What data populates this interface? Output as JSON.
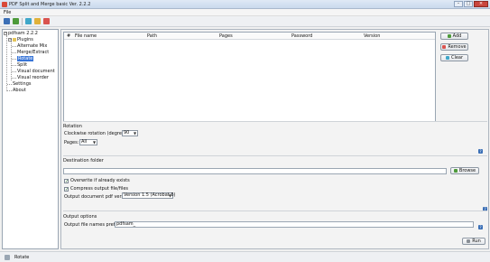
{
  "window": {
    "title": "PDF Split and Merge basic Ver. 2.2.2",
    "buttons": [
      "–",
      "□",
      "×"
    ]
  },
  "menu": {
    "file": "File"
  },
  "toolbar": {
    "icons": [
      "save-icon",
      "open-icon",
      "envelope-icon",
      "pen-icon",
      "cancel-icon"
    ]
  },
  "tree": {
    "root": "pdfsam 2.2.2",
    "plugins": "Plugins",
    "items": [
      "Alternate Mix",
      "Merge/Extract",
      "Rotate",
      "Split",
      "Visual document",
      "Visual reorder"
    ],
    "settings": "Settings",
    "about": "About",
    "selected": "Rotate"
  },
  "table": {
    "columns": [
      "#",
      "File name",
      "Path",
      "Pages",
      "Password",
      "Version"
    ]
  },
  "side_buttons": {
    "add": "Add",
    "remove": "Remove",
    "clear": "Clear"
  },
  "rotation": {
    "section": "Rotation",
    "clockwise_label": "Clockwise rotation (degrees):",
    "clockwise_value": "90",
    "pages_label": "Pages:",
    "pages_value": "All"
  },
  "destination": {
    "section": "Destination folder",
    "folder_value": "",
    "browse": "Browse",
    "overwrite": "Overwrite if already exists",
    "compress": "Compress output file/files",
    "version_label": "Output document pdf version:",
    "version_value": "Version 1.5 (Acrobat 6)"
  },
  "output": {
    "section": "Output options",
    "prefix_label": "Output file names prefix:",
    "prefix_value": "pdfsam_"
  },
  "run": "Run",
  "status": {
    "text": "Rotate"
  },
  "colors": {
    "accent": "#3875d7",
    "selected_bg": "#3875d7"
  }
}
